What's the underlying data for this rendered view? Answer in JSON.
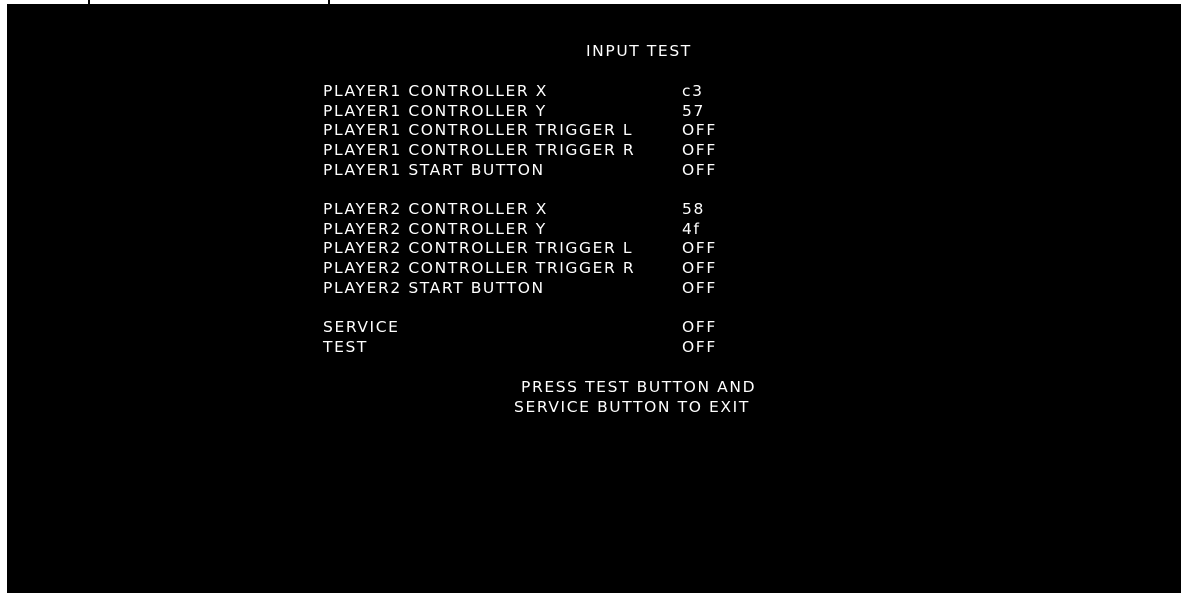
{
  "title": "INPUT TEST",
  "player1": [
    {
      "label": "PLAYER1 CONTROLLER X",
      "value": "c3"
    },
    {
      "label": "PLAYER1 CONTROLLER Y",
      "value": "57"
    },
    {
      "label": "PLAYER1 CONTROLLER TRIGGER L",
      "value": "OFF"
    },
    {
      "label": "PLAYER1 CONTROLLER TRIGGER R",
      "value": "OFF"
    },
    {
      "label": "PLAYER1 START BUTTON",
      "value": "OFF"
    }
  ],
  "player2": [
    {
      "label": "PLAYER2 CONTROLLER X",
      "value": "58"
    },
    {
      "label": "PLAYER2 CONTROLLER Y",
      "value": "4f"
    },
    {
      "label": "PLAYER2 CONTROLLER TRIGGER L",
      "value": "OFF"
    },
    {
      "label": "PLAYER2 CONTROLLER TRIGGER R",
      "value": "OFF"
    },
    {
      "label": "PLAYER2 START BUTTON",
      "value": "OFF"
    }
  ],
  "system": [
    {
      "label": "SERVICE",
      "value": "OFF"
    },
    {
      "label": "TEST",
      "value": "OFF"
    }
  ],
  "footer": {
    "line1": "PRESS TEST BUTTON AND",
    "line2": "SERVICE BUTTON TO EXIT"
  },
  "colors": {
    "background": "#000000",
    "text": "#ffffff"
  }
}
